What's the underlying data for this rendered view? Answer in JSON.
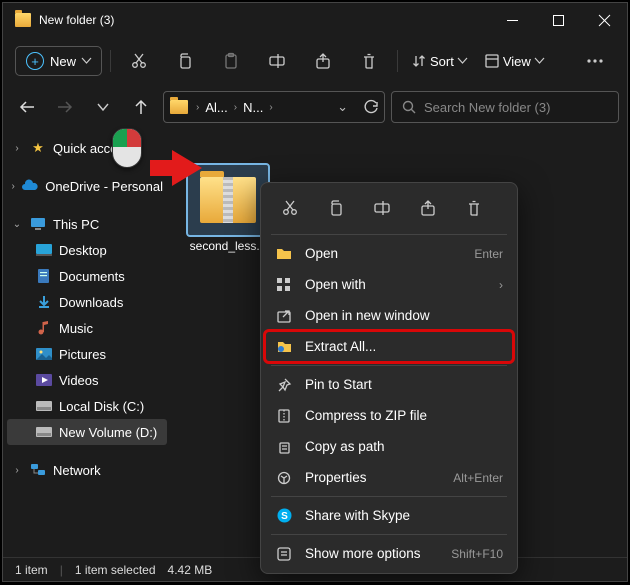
{
  "window": {
    "title": "New folder (3)"
  },
  "toolbar": {
    "new_label": "New",
    "sort_label": "Sort",
    "view_label": "View"
  },
  "breadcrumb": {
    "seg1": "Al...",
    "seg2": "N..."
  },
  "search": {
    "placeholder": "Search New folder (3)"
  },
  "sidebar": {
    "quick": "Quick access",
    "onedrive": "OneDrive - Personal",
    "thispc": "This PC",
    "desktop": "Desktop",
    "documents": "Documents",
    "downloads": "Downloads",
    "music": "Music",
    "pictures": "Pictures",
    "videos": "Videos",
    "localdisk": "Local Disk (C:)",
    "newvolume": "New Volume (D:)",
    "network": "Network"
  },
  "file": {
    "name": "second_less..."
  },
  "ctx": {
    "open": "Open",
    "open_hint": "Enter",
    "openwith": "Open with",
    "newwindow": "Open in new window",
    "extract": "Extract All...",
    "pin": "Pin to Start",
    "compress": "Compress to ZIP file",
    "copypath": "Copy as path",
    "properties": "Properties",
    "properties_hint": "Alt+Enter",
    "skype": "Share with Skype",
    "more": "Show more options",
    "more_hint": "Shift+F10"
  },
  "status": {
    "count": "1 item",
    "selection": "1 item selected",
    "size": "4.42 MB"
  }
}
